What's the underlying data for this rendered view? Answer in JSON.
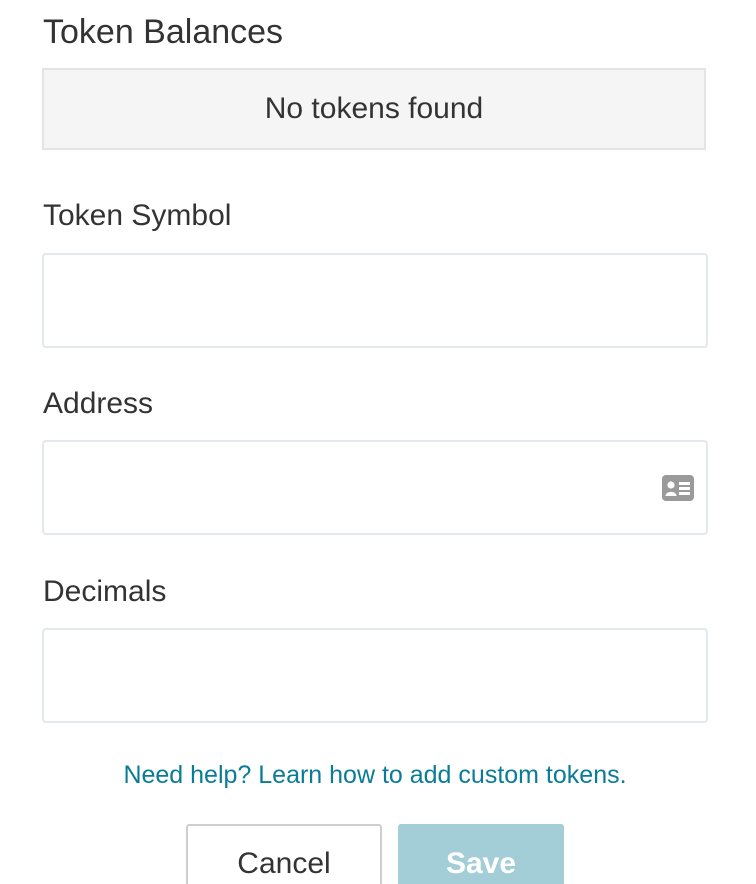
{
  "token_balances": {
    "title": "Token Balances",
    "empty_message": "No tokens found"
  },
  "form": {
    "symbol": {
      "label": "Token Symbol",
      "value": "",
      "placeholder": ""
    },
    "address": {
      "label": "Address",
      "value": "",
      "placeholder": "",
      "icon": "contact-card-icon"
    },
    "decimals": {
      "label": "Decimals",
      "value": "",
      "placeholder": ""
    }
  },
  "help": {
    "link_text": "Need help? Learn how to add custom tokens."
  },
  "actions": {
    "cancel_label": "Cancel",
    "save_label": "Save"
  },
  "colors": {
    "link": "#0a7c96",
    "save_button": "#a4ced7",
    "empty_box_bg": "#f5f5f5"
  }
}
